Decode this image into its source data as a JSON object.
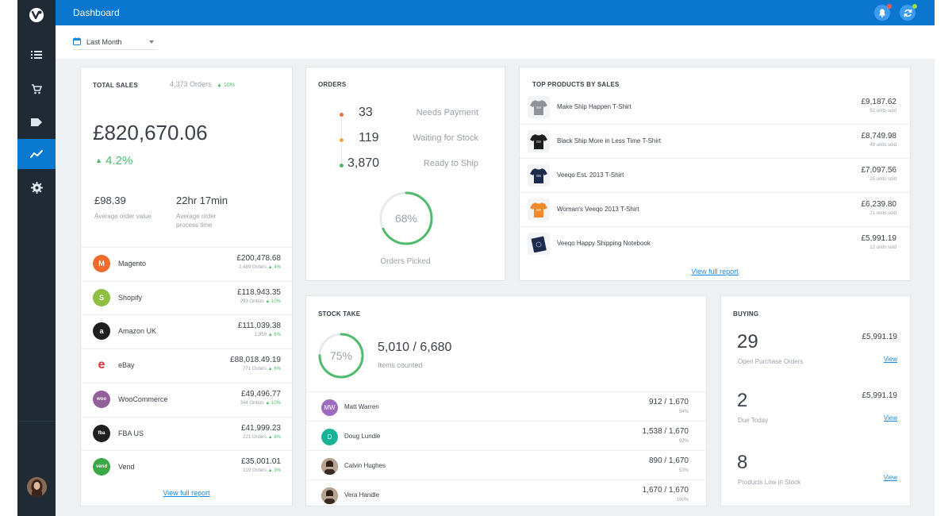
{
  "topbar": {
    "title": "Dashboard"
  },
  "filter": {
    "period": "Last Month"
  },
  "sidebar": {
    "items": [
      {
        "name": "list-icon"
      },
      {
        "name": "cart-icon"
      },
      {
        "name": "tag-icon"
      },
      {
        "name": "analytics-icon",
        "active": true
      },
      {
        "name": "gear-icon"
      }
    ]
  },
  "total_sales": {
    "title": "TOTAL SALES",
    "orders": "4,373 Orders",
    "orders_change": "10%",
    "amount": "£820,670.06",
    "change": "4.2%",
    "avg_order_value": "£98.39",
    "avg_order_value_label": "Average order value",
    "avg_process_time": "22hr 17min",
    "avg_process_time_label": "Average order process time",
    "channels": [
      {
        "name": "Magento",
        "value": "£200,478.68",
        "orders": "2,489 Orders",
        "change": "4%",
        "color": "#ef6c2f",
        "glyph": "M"
      },
      {
        "name": "Shopify",
        "value": "£118,943.35",
        "orders": "293 Orders",
        "change": "10%",
        "color": "#8dbf42",
        "glyph": "S"
      },
      {
        "name": "Amazon UK",
        "value": "£111,039.38",
        "orders": "1,859",
        "change": "6%",
        "color": "#1f1f1f",
        "glyph": "a"
      },
      {
        "name": "eBay",
        "value": "£88,018.49.19",
        "orders": "771 Orders",
        "change": "6%",
        "color": "#ffffff",
        "glyph": "e"
      },
      {
        "name": "WooCommerce",
        "value": "£49,496.77",
        "orders": "344 Orders",
        "change": "10%",
        "color": "#93609b",
        "glyph": "woo"
      },
      {
        "name": "FBA US",
        "value": "£41,999.23",
        "orders": "221 Orders",
        "change": "8%",
        "color": "#1f1f1f",
        "glyph": "fba"
      },
      {
        "name": "Vend",
        "value": "£35,001.01",
        "orders": "219 Orders",
        "change": "3%",
        "color": "#3aa845",
        "glyph": "vend"
      }
    ],
    "link": "View full report"
  },
  "orders": {
    "title": "ORDERS",
    "rows": [
      {
        "count": "33",
        "label": "Needs Payment",
        "color": "#e8743b"
      },
      {
        "count": "119",
        "label": "Waiting for Stock",
        "color": "#f5a540"
      },
      {
        "count": "3,870",
        "label": "Ready to Ship",
        "color": "#4fbc6b"
      }
    ],
    "picked_percent": 68,
    "picked_percent_label": "68%",
    "picked_label": "Orders Picked"
  },
  "top_products": {
    "title": "TOP PRODUCTS BY SALES",
    "items": [
      {
        "name": "Make Ship Happen  T-Shirt",
        "value": "£9,187.62",
        "units": "52 units sold",
        "color": "#8e9399"
      },
      {
        "name": "Black Ship More in Less Time T-Shirt",
        "value": "£8,749.98",
        "units": "49 units sold",
        "color": "#1d1d1f"
      },
      {
        "name": "Veeqo Est. 2013 T-Shirt",
        "value": "£7,097.56",
        "units": "25 units sold",
        "color": "#1e2a4d"
      },
      {
        "name": "Woman's Veeqo 2013 T-Shirt",
        "value": "£6,239.80",
        "units": "21 units sold",
        "color": "#f08a2a"
      },
      {
        "name": "Veeqo Happy Shipping Notebook",
        "value": "£5,991.19",
        "units": "12 units sold",
        "color": "#1e2a4d"
      }
    ],
    "link": "View full report"
  },
  "stock_take": {
    "title": "STOCK TAKE",
    "percent": 75,
    "percent_label": "75%",
    "counted": "5,010 / 6,680",
    "counted_label": "Items counted",
    "people": [
      {
        "initials": "MW",
        "name": "Matt Warren",
        "value": "912 / 1,670",
        "pct": "54%",
        "color": "#9f6bc0"
      },
      {
        "initials": "D",
        "name": "Doug Lundie",
        "value": "1,538 / 1,670",
        "pct": "92%",
        "color": "#19b39a"
      },
      {
        "initials": "",
        "name": "Calvin Hughes",
        "value": "890 / 1,670",
        "pct": "53%",
        "color": "#4a3a2f"
      },
      {
        "initials": "",
        "name": "Vera Handle",
        "value": "1,670 / 1,670",
        "pct": "100%",
        "color": "#6a4a36"
      }
    ]
  },
  "buying": {
    "title": "BUYING",
    "items": [
      {
        "count": "29",
        "label": "Open Purchase Orders",
        "value": "£5,991.19",
        "link": "View"
      },
      {
        "count": "2",
        "label": "Due Today",
        "value": "£5,991.19",
        "link": "View"
      },
      {
        "count": "8",
        "label": "Products Low in Stock",
        "value": "",
        "link": "View"
      }
    ]
  }
}
